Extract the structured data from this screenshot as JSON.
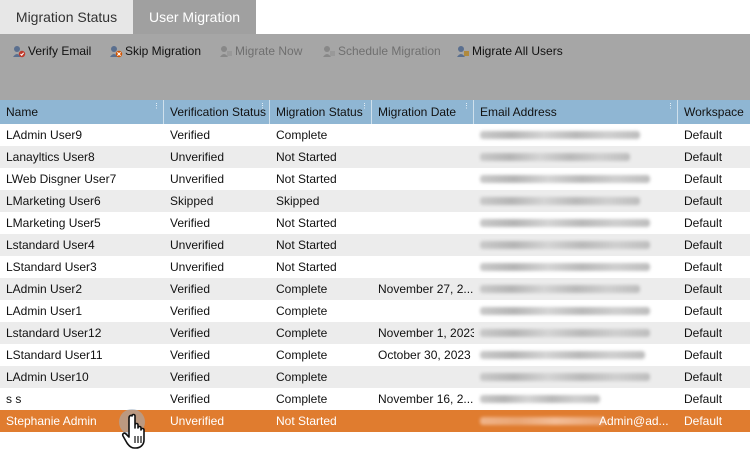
{
  "tabs": [
    {
      "label": "Migration Status",
      "active": false
    },
    {
      "label": "User Migration",
      "active": true
    }
  ],
  "toolbar": {
    "buttons": [
      {
        "label": "Verify Email",
        "icon": "verify-email-icon",
        "enabled": true
      },
      {
        "label": "Skip Migration",
        "icon": "skip-migration-icon",
        "enabled": true
      },
      {
        "label": "Migrate Now",
        "icon": "migrate-now-icon",
        "enabled": false
      },
      {
        "label": "Schedule Migration",
        "icon": "schedule-migration-icon",
        "enabled": false
      },
      {
        "label": "Migrate All Users",
        "icon": "migrate-all-users-icon",
        "enabled": true
      }
    ]
  },
  "grid": {
    "columns": [
      "Name",
      "Verification Status",
      "Migration Status",
      "Migration Date",
      "Email Address",
      "Workspace"
    ],
    "rows": [
      {
        "name": "LAdmin User9",
        "verification": "Verified",
        "migration": "Complete",
        "date": "",
        "email": "",
        "workspace": "Default"
      },
      {
        "name": "Lanayltics User8",
        "verification": "Unverified",
        "migration": "Not Started",
        "date": "",
        "email": "",
        "workspace": "Default"
      },
      {
        "name": "LWeb Disgner User7",
        "verification": "Unverified",
        "migration": "Not Started",
        "date": "",
        "email": "",
        "workspace": "Default"
      },
      {
        "name": "LMarketing User6",
        "verification": "Skipped",
        "migration": "Skipped",
        "date": "",
        "email": "",
        "workspace": "Default"
      },
      {
        "name": "LMarketing User5",
        "verification": "Verified",
        "migration": "Not Started",
        "date": "",
        "email": "",
        "workspace": "Default"
      },
      {
        "name": "Lstandard User4",
        "verification": "Unverified",
        "migration": "Not Started",
        "date": "",
        "email": "",
        "workspace": "Default"
      },
      {
        "name": "LStandard User3",
        "verification": "Unverified",
        "migration": "Not Started",
        "date": "",
        "email": "",
        "workspace": "Default"
      },
      {
        "name": "LAdmin User2",
        "verification": "Verified",
        "migration": "Complete",
        "date": "November 27, 2...",
        "email": "",
        "workspace": "Default"
      },
      {
        "name": "LAdmin User1",
        "verification": "Verified",
        "migration": "Complete",
        "date": "",
        "email": "",
        "workspace": "Default"
      },
      {
        "name": "Lstandard User12",
        "verification": "Verified",
        "migration": "Complete",
        "date": "November 1, 2023",
        "email": "",
        "workspace": "Default"
      },
      {
        "name": "LStandard User11",
        "verification": "Verified",
        "migration": "Complete",
        "date": "October 30, 2023",
        "email": "",
        "workspace": "Default"
      },
      {
        "name": "LAdmin User10",
        "verification": "Verified",
        "migration": "Complete",
        "date": "",
        "email": "",
        "workspace": "Default"
      },
      {
        "name": "s s",
        "verification": "Verified",
        "migration": "Complete",
        "date": "November 16, 2...",
        "email": "",
        "workspace": "Default"
      },
      {
        "name": "Stephanie Admin",
        "verification": "Unverified",
        "migration": "Not Started",
        "date": "",
        "email": "Admin@ad...",
        "workspace": "Default",
        "selected": true
      }
    ]
  },
  "colors": {
    "header_bg": "#8fb6d3",
    "toolbar_bg": "#a6a6a6",
    "active_tab_bg": "#a0a0a0",
    "selected_row_bg": "#e07c2f",
    "alt_row_bg": "#ececec"
  },
  "cursor": {
    "icon": "hand-pointer-icon"
  }
}
